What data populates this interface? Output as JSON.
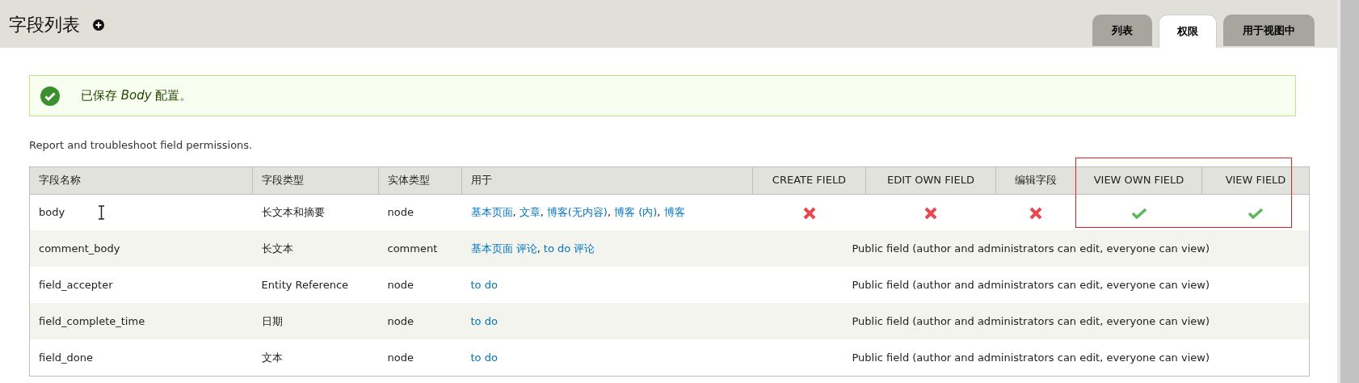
{
  "page_title": "字段列表",
  "tabs": [
    {
      "label": "列表",
      "selected": false
    },
    {
      "label": "权限",
      "selected": true
    },
    {
      "label": "用于视图中",
      "selected": false
    }
  ],
  "message": {
    "text": "已保存 *Body* 配置。"
  },
  "description": "Report and troubleshoot field permissions.",
  "table": {
    "link_separator": ",",
    "columns": [
      "字段名称",
      "字段类型",
      "实体类型",
      "用于",
      "CREATE FIELD",
      "EDIT OWN FIELD",
      "编辑字段",
      "VIEW OWN FIELD",
      "VIEW FIELD"
    ],
    "rows": [
      {
        "name": "body",
        "type": "长文本和摘要",
        "entity": "node",
        "used_in": [
          "基本页面",
          "文章",
          "博客(无内容)",
          "博客 (内)",
          "博客"
        ],
        "permissions": [
          {
            "granted": false
          },
          {
            "granted": false
          },
          {
            "granted": false
          },
          {
            "granted": true
          },
          {
            "granted": true
          }
        ]
      },
      {
        "name": "comment_body",
        "type": "长文本",
        "entity": "comment",
        "used_in": [
          "基本页面 评论",
          "to do 评论"
        ],
        "note": "Public field (author and administrators can edit, everyone can view)"
      },
      {
        "name": "field_accepter",
        "type": "Entity Reference",
        "entity": "node",
        "used_in": [
          "to do"
        ],
        "note": "Public field (author and administrators can edit, everyone can view)"
      },
      {
        "name": "field_complete_time",
        "type": "日期",
        "entity": "node",
        "used_in": [
          "to do"
        ],
        "note": "Public field (author and administrators can edit, everyone can view)"
      },
      {
        "name": "field_done",
        "type": "文本",
        "entity": "node",
        "used_in": [
          "to do"
        ],
        "note": "Public field (author and administrators can edit, everyone can view)"
      }
    ]
  }
}
